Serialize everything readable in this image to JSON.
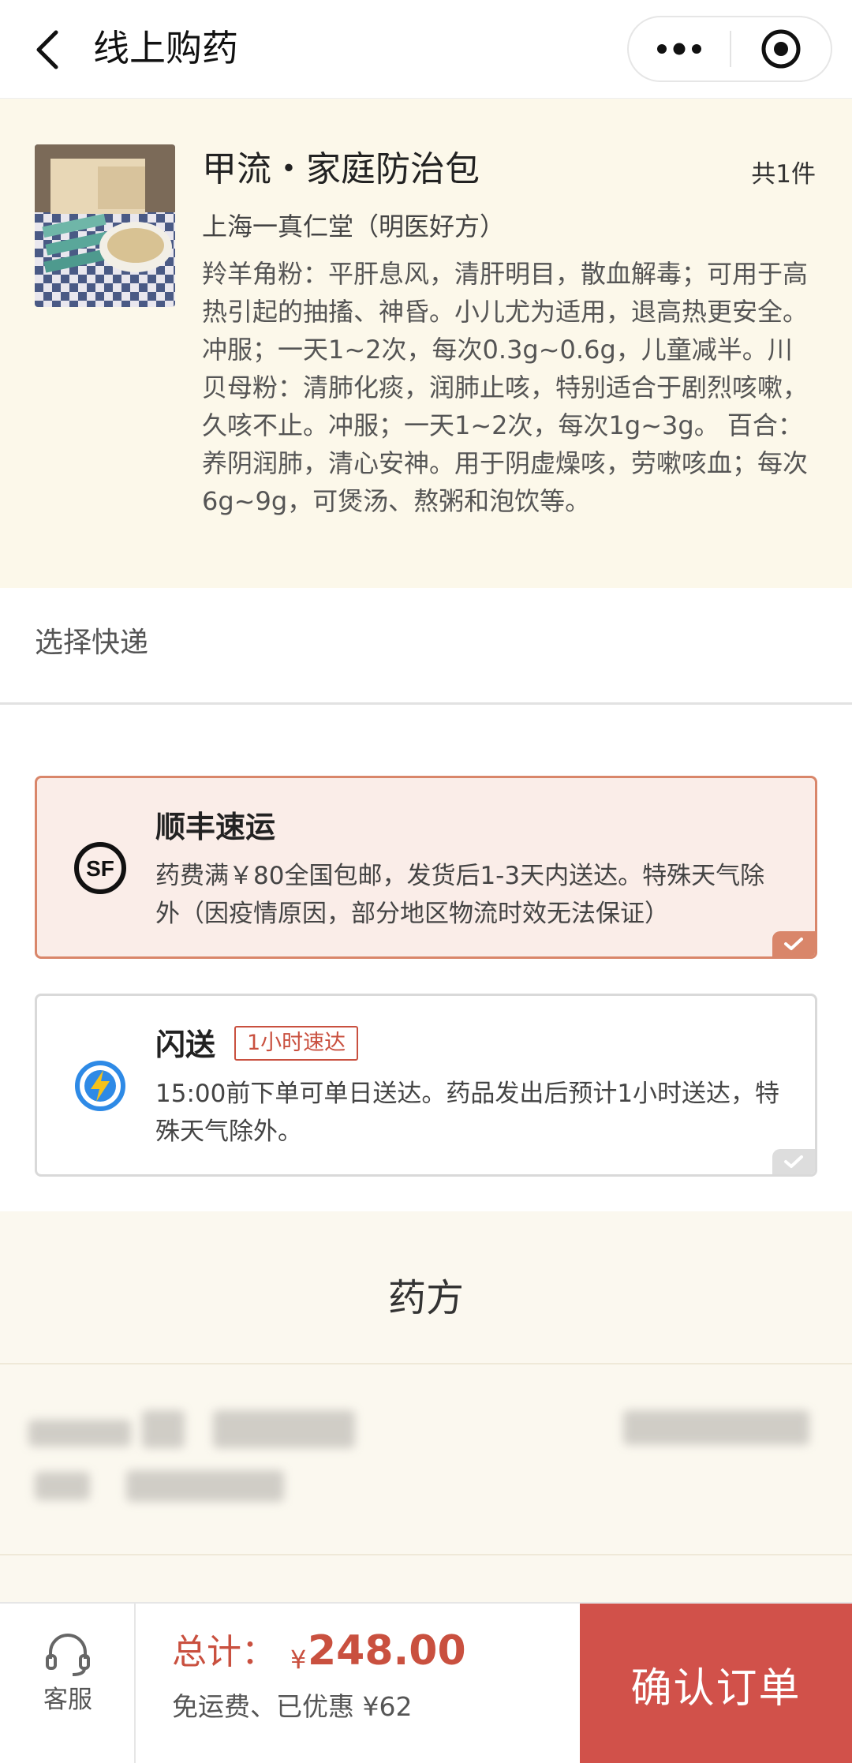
{
  "header": {
    "title": "线上购药",
    "back_icon": "chevron-left-icon",
    "more_icon": "more-dots-icon",
    "close_icon": "target-close-icon"
  },
  "product": {
    "name": "甲流・家庭防治包",
    "count": "共1件",
    "maker": "上海一真仁堂（明医好方）",
    "description": "羚羊角粉：平肝息风，清肝明目，散血解毒；可用于高热引起的抽搐、神昏。小儿尤为适用，退高热更安全。冲服；一天1~2次，每次0.3g~0.6g，儿童减半。川贝母粉：清肺化痰，润肺止咳，特别适合于剧烈咳嗽，久咳不止。冲服；一天1~2次，每次1g~3g。 百合：养阴润肺，清心安神。用于阴虚燥咳，劳嗽咳血；每次6g~9g，可煲汤、熬粥和泡饮等。"
  },
  "express": {
    "label": "选择快递",
    "options": [
      {
        "title": "顺丰速运",
        "badge": "",
        "description": "药费满￥80全国包邮，发货后1-3天内送达。特殊天气除外（因疫情原因，部分地区物流时效无法保证）",
        "selected": true,
        "icon": "sf-express-icon"
      },
      {
        "title": "闪送",
        "badge": "1小时速达",
        "description": "15:00前下单可单日送达。药品发出后预计1小时送达，特殊天气除外。",
        "selected": false,
        "icon": "lightning-icon"
      }
    ]
  },
  "prescription": {
    "title": "药方"
  },
  "bottom_bar": {
    "service_label": "客服",
    "service_icon": "headset-icon",
    "total_label": "总计：",
    "total_currency": "¥",
    "total_amount": "248.00",
    "total_sub": "免运费、已优惠 ¥62",
    "confirm_label": "确认订单"
  },
  "colors": {
    "accent": "#c9503f",
    "confirm_bg": "#d1514a",
    "product_bg": "#fcf8ea",
    "selected_border": "#d9866a"
  }
}
